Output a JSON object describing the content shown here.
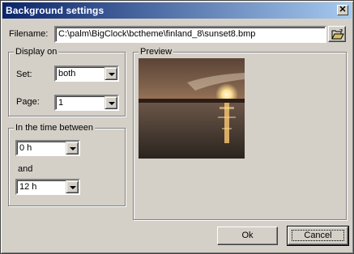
{
  "window": {
    "title": "Background settings"
  },
  "filename": {
    "label": "Filename:",
    "value": "C:\\palm\\BigClock\\bctheme\\finland_8\\sunset8.bmp"
  },
  "display_on": {
    "title": "Display on",
    "set_label": "Set:",
    "set_value": "both",
    "page_label": "Page:",
    "page_value": "1"
  },
  "time_between": {
    "title": "In the time between",
    "from_value": "0 h",
    "and_label": "and",
    "to_value": "12 h"
  },
  "preview": {
    "title": "Preview"
  },
  "buttons": {
    "ok": "Ok",
    "cancel": "Cancel"
  },
  "icons": {
    "close": "close-icon",
    "browse": "folder-open-icon",
    "dropdown": "chevron-down-icon"
  }
}
